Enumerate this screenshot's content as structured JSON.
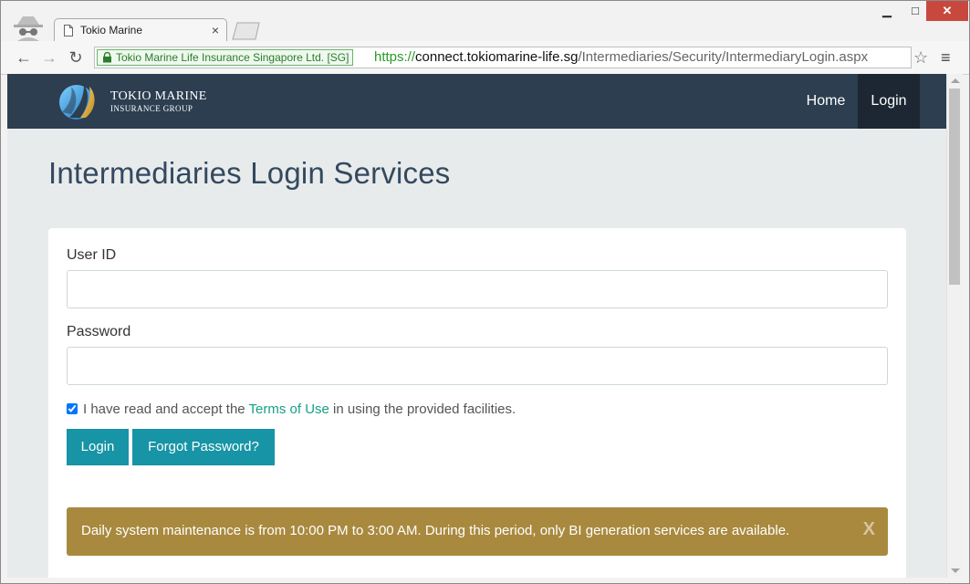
{
  "browser": {
    "tab_title": "Tokio Marine",
    "tab_close": "×",
    "ev_label": "Tokio Marine Life Insurance Singapore Ltd. [SG]",
    "url_scheme": "https://",
    "url_host": "connect.tokiomarine-life.sg",
    "url_path": "/Intermediaries/Security/IntermediaryLogin.aspx",
    "back": "←",
    "forward": "→",
    "reload": "↻",
    "star": "☆",
    "menu": "≡",
    "win_min": "▁",
    "win_max": "□",
    "win_close": "✕"
  },
  "site": {
    "logo_line1": "TOKIO MARINE",
    "logo_line2": "INSURANCE GROUP",
    "nav": {
      "home": "Home",
      "login": "Login"
    },
    "brand_colors": {
      "navbar": "#2c3e50",
      "button": "#1794a5",
      "alert": "#a8893e",
      "link": "#16a085"
    }
  },
  "main": {
    "title": "Intermediaries Login Services",
    "form": {
      "user_label": "User ID",
      "user_value": "",
      "password_label": "Password",
      "password_value": "",
      "agree_prefix": "I have read and accept the ",
      "agree_link": "Terms of Use",
      "agree_suffix": " in using the provided facilities.",
      "agree_checked": true,
      "login_button": "Login",
      "forgot_button": "Forgot Password?"
    },
    "alert": {
      "text": "Daily system maintenance is from 10:00 PM to 3:00 AM. During this period, only BI generation services are available.",
      "close": "X"
    }
  }
}
